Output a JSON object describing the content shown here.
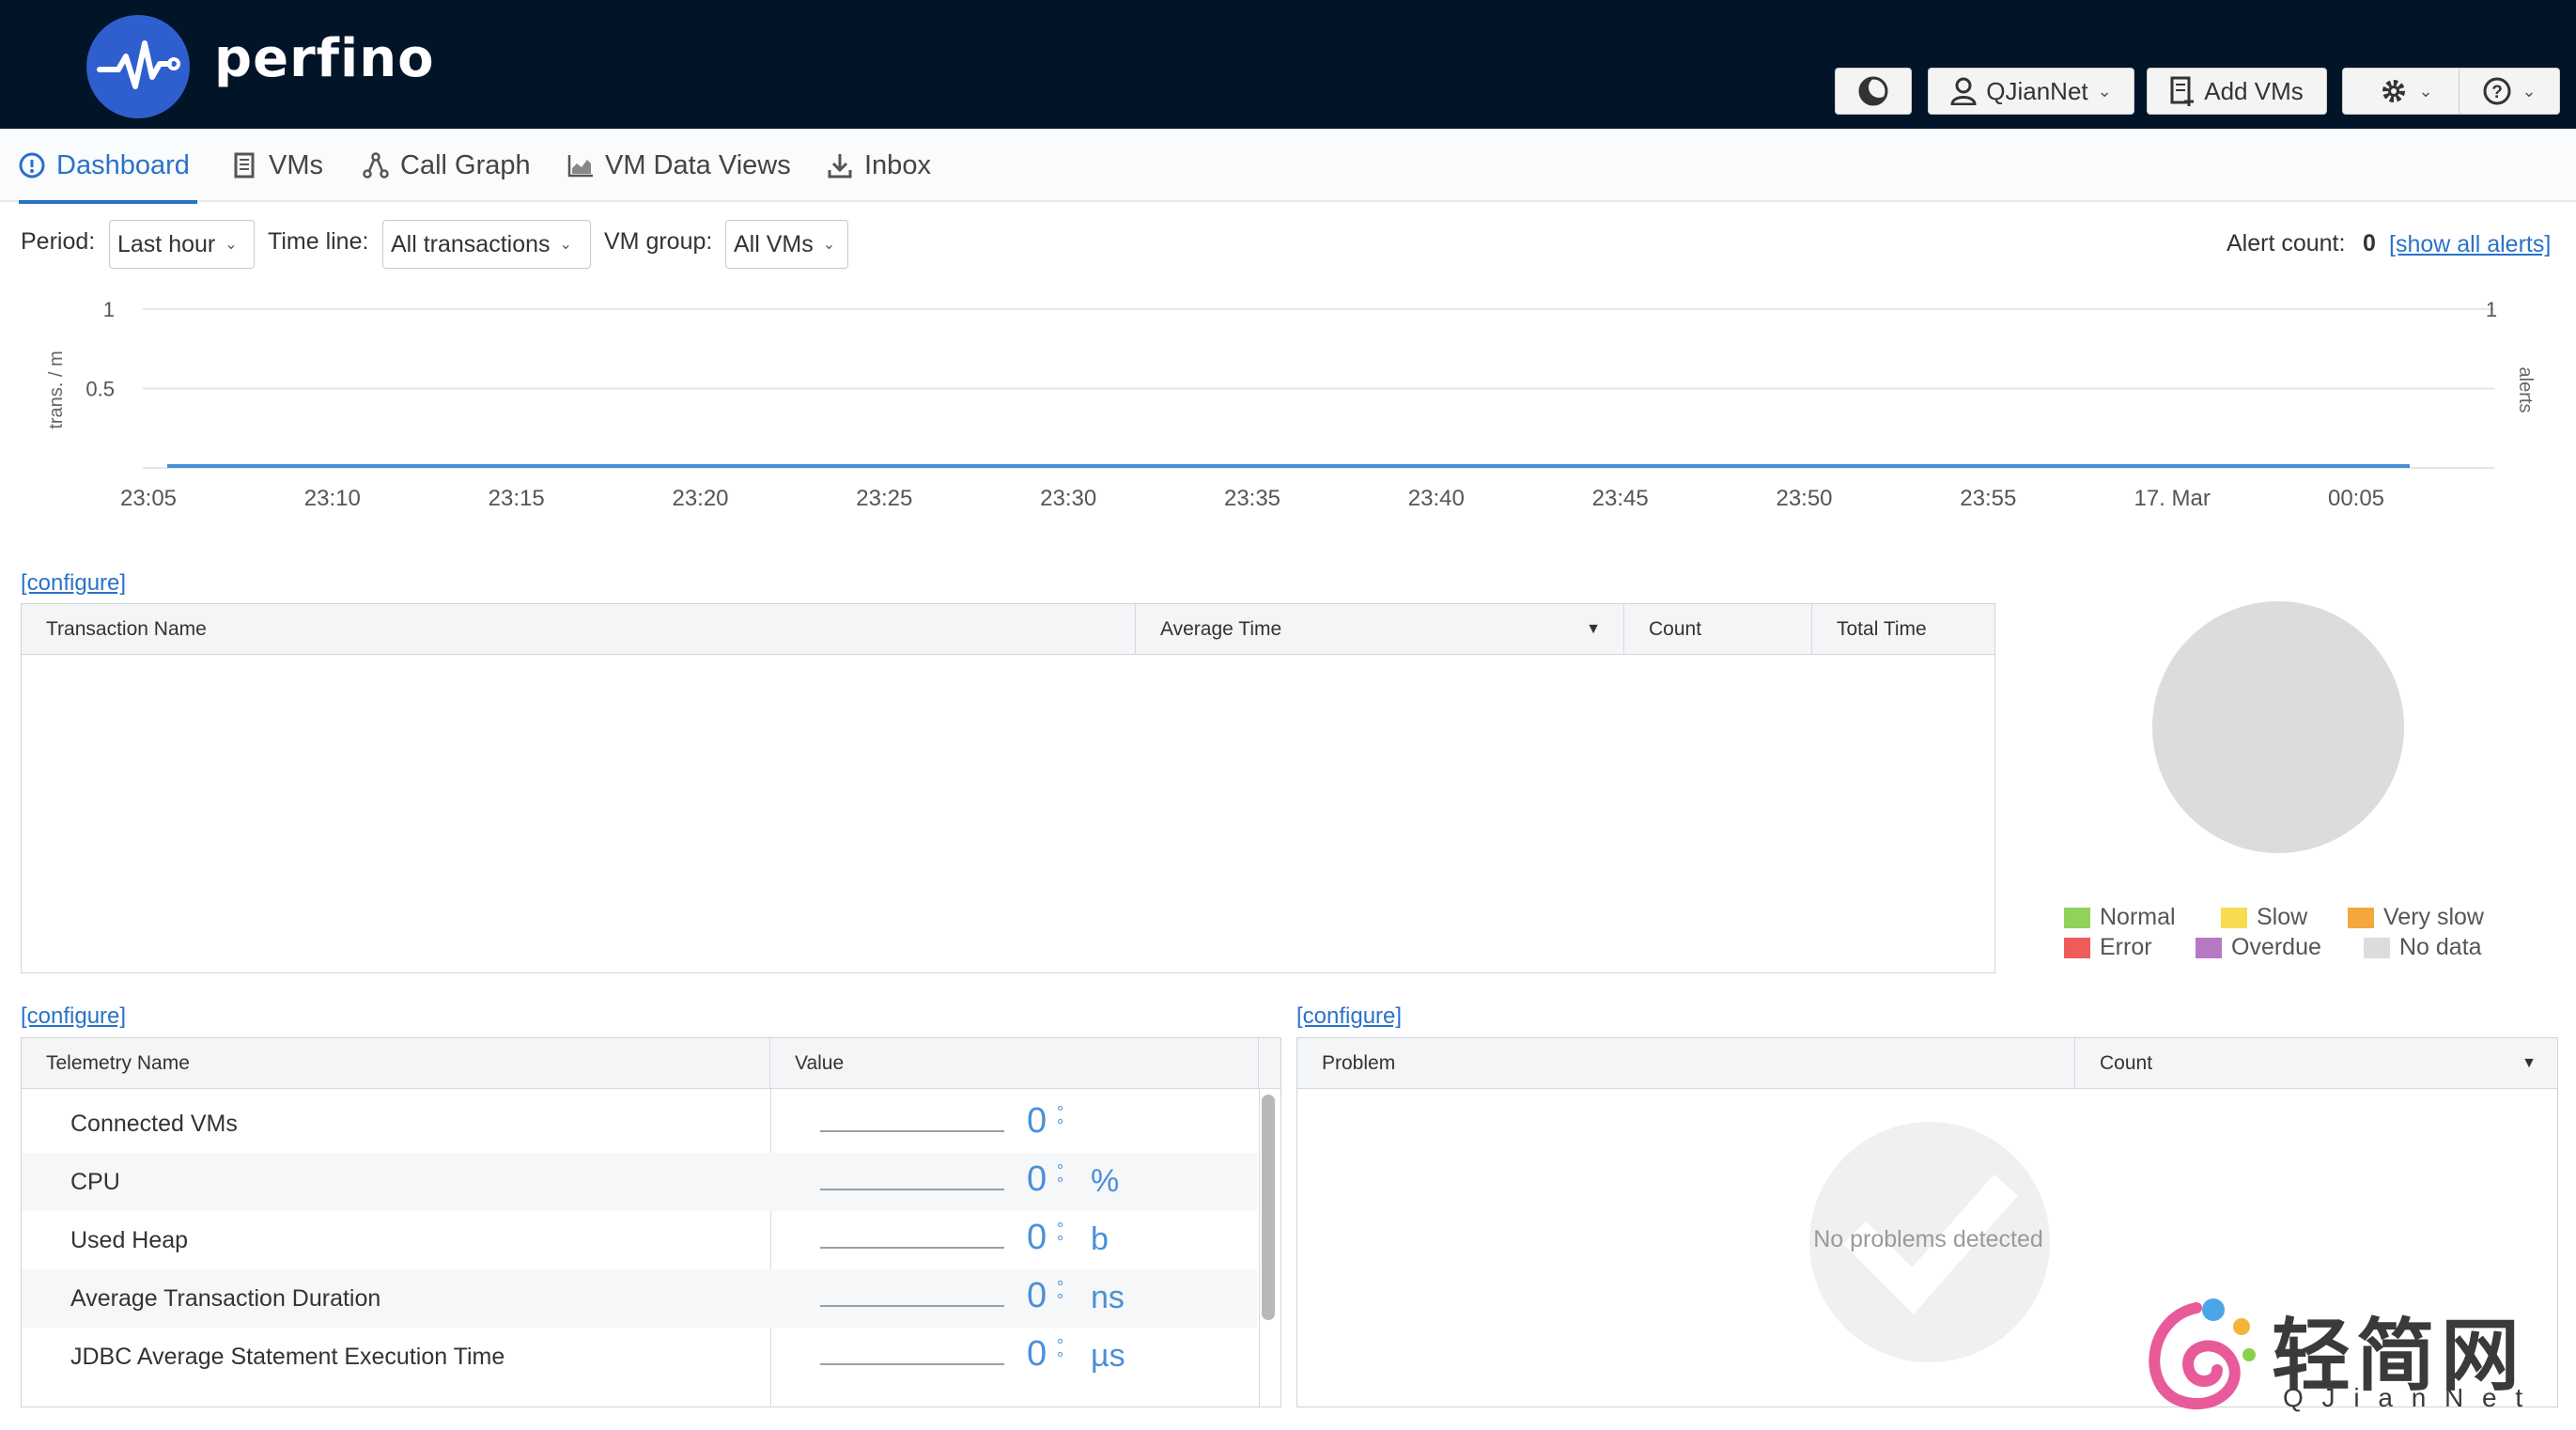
{
  "header": {
    "app_name": "perfino",
    "theme_icon": "moon-icon",
    "user_label": "QJianNet",
    "add_vms_label": "Add VMs",
    "settings_icon": "gear-icon",
    "help_icon": "help-icon"
  },
  "nav": {
    "tabs": [
      {
        "label": "Dashboard",
        "icon": "dashboard-icon",
        "active": true
      },
      {
        "label": "VMs",
        "icon": "server-icon",
        "active": false
      },
      {
        "label": "Call Graph",
        "icon": "call-graph-icon",
        "active": false
      },
      {
        "label": "VM Data Views",
        "icon": "chart-icon",
        "active": false
      },
      {
        "label": "Inbox",
        "icon": "download-icon",
        "active": false
      }
    ]
  },
  "filters": {
    "period_label": "Period:",
    "period_value": "Last hour",
    "timeline_label": "Time line:",
    "timeline_value": "All transactions",
    "vmgroup_label": "VM group:",
    "vmgroup_value": "All VMs",
    "alert_count_label": "Alert count:",
    "alert_count_value": "0",
    "show_alerts_link": "[show all alerts]"
  },
  "chart_data": {
    "type": "line",
    "x": [
      "23:05",
      "23:10",
      "23:15",
      "23:20",
      "23:25",
      "23:30",
      "23:35",
      "23:40",
      "23:45",
      "23:50",
      "23:55",
      "17. Mar",
      "00:05"
    ],
    "series": [
      {
        "values": [
          0,
          0,
          0,
          0,
          0,
          0,
          0,
          0,
          0,
          0,
          0,
          0,
          0
        ],
        "color": "#4a90d9"
      }
    ],
    "ylabel": "trans. / m",
    "y2label": "alerts",
    "y_ticks": [
      "0.5",
      "1"
    ],
    "y2_ticks": [
      "1"
    ],
    "ylim": [
      0,
      1
    ],
    "grid": true
  },
  "transactions": {
    "configure_link": "[configure]",
    "columns": [
      "Transaction Name",
      "Average Time",
      "Count",
      "Total Time"
    ],
    "rows": [],
    "pie_legend": [
      {
        "label": "Normal",
        "color": "#8fd35a"
      },
      {
        "label": "Slow",
        "color": "#f6dc4e"
      },
      {
        "label": "Very slow",
        "color": "#f4a73c"
      },
      {
        "label": "Error",
        "color": "#ef5a5a"
      },
      {
        "label": "Overdue",
        "color": "#b678c2"
      },
      {
        "label": "No data",
        "color": "#dcdcdc"
      }
    ]
  },
  "telemetry": {
    "configure_link": "[configure]",
    "columns": [
      "Telemetry Name",
      "Value"
    ],
    "rows": [
      {
        "name": "Connected VMs",
        "value": "0",
        "unit": ""
      },
      {
        "name": "CPU",
        "value": "0",
        "unit": "%"
      },
      {
        "name": "Used Heap",
        "value": "0",
        "unit": "b"
      },
      {
        "name": "Average Transaction Duration",
        "value": "0",
        "unit": "ns"
      },
      {
        "name": "JDBC Average Statement Execution Time",
        "value": "0",
        "unit": "µs"
      }
    ]
  },
  "problems": {
    "configure_link": "[configure]",
    "columns": [
      "Problem",
      "Count"
    ],
    "empty_text": "No problems detected"
  },
  "watermark": {
    "text": "轻简网",
    "subtext": "Q J i a n N e t"
  }
}
